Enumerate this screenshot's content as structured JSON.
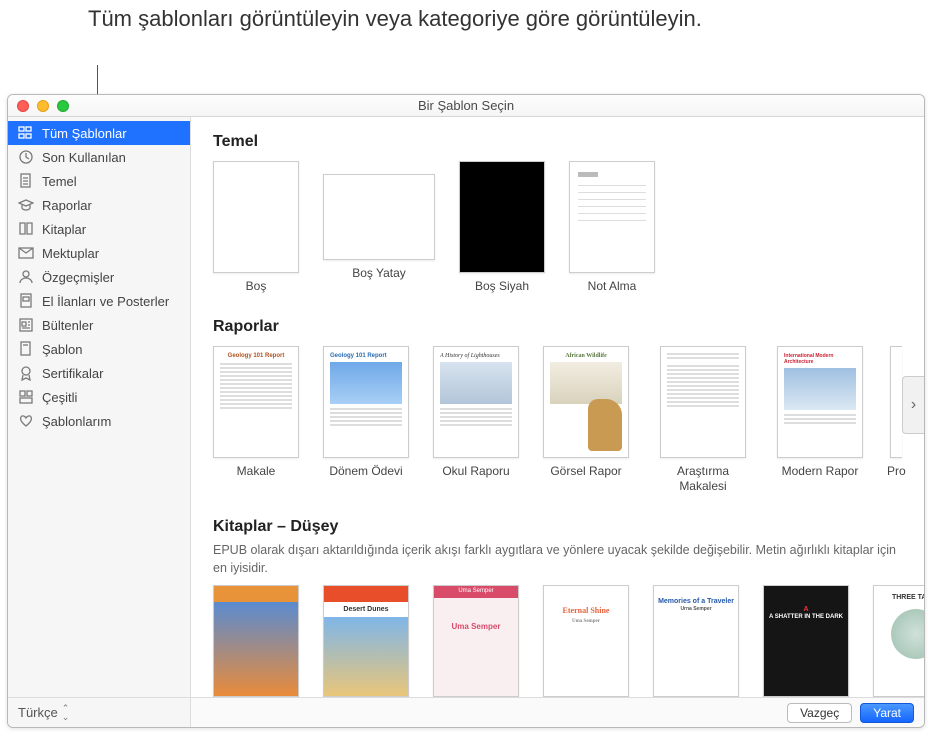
{
  "callout_text": "Tüm şablonları görüntüleyin veya kategoriye göre görüntüleyin.",
  "window_title": "Bir Şablon Seçin",
  "sidebar": {
    "categories": [
      {
        "label": "Tüm Şablonlar",
        "icon": "grid",
        "selected": true
      },
      {
        "label": "Son Kullanılan",
        "icon": "clock",
        "selected": false
      },
      {
        "label": "Temel",
        "icon": "doc",
        "selected": false
      },
      {
        "label": "Raporlar",
        "icon": "gradcap",
        "selected": false
      },
      {
        "label": "Kitaplar",
        "icon": "book",
        "selected": false
      },
      {
        "label": "Mektuplar",
        "icon": "envelope",
        "selected": false
      },
      {
        "label": "Özgeçmişler",
        "icon": "person",
        "selected": false
      },
      {
        "label": "El İlanları ve Posterler",
        "icon": "poster",
        "selected": false
      },
      {
        "label": "Bültenler",
        "icon": "news",
        "selected": false
      },
      {
        "label": "Şablon",
        "icon": "stationery",
        "selected": false
      },
      {
        "label": "Sertifikalar",
        "icon": "ribbon",
        "selected": false
      },
      {
        "label": "Çeşitli",
        "icon": "misc",
        "selected": false
      },
      {
        "label": "Şablonlarım",
        "icon": "heart",
        "selected": false
      }
    ],
    "language": "Türkçe"
  },
  "sections": {
    "temel": {
      "title": "Temel",
      "templates": [
        {
          "label": "Boş"
        },
        {
          "label": "Boş Yatay"
        },
        {
          "label": "Boş Siyah"
        },
        {
          "label": "Not Alma"
        }
      ]
    },
    "raporlar": {
      "title": "Raporlar",
      "templates": [
        {
          "label": "Makale",
          "thumb_title": "Geology 101 Report"
        },
        {
          "label": "Dönem Ödevi",
          "thumb_title": "Geology 101 Report"
        },
        {
          "label": "Okul Raporu",
          "thumb_title": "A History of Lighthouses"
        },
        {
          "label": "Görsel Rapor",
          "thumb_title": "African Wildlife"
        },
        {
          "label": "Araştırma Makalesi"
        },
        {
          "label": "Modern Rapor",
          "thumb_title": "International Modern Architecture"
        },
        {
          "label": "Pro",
          "partial": true
        }
      ]
    },
    "kitaplar": {
      "title": "Kitaplar – Düşey",
      "subtitle": "EPUB olarak dışarı aktarıldığında içerik akışı farklı aygıtlara ve yönlere uyacak şekilde değişebilir. Metin ağırlıklı kitaplar için en iyisidir.",
      "templates": [
        {
          "cover_title": ""
        },
        {
          "cover_title": "Desert Dunes"
        },
        {
          "cover_title": "Uma Semper"
        },
        {
          "cover_title": "Eternal Shine",
          "cover_author": "Uma Semper"
        },
        {
          "cover_title": "Memories of a Traveler",
          "cover_author": "Urna Semper"
        },
        {
          "cover_title": "A SHATTER IN THE DARK"
        },
        {
          "cover_title": "THREE TALES"
        }
      ]
    }
  },
  "footer": {
    "cancel": "Vazgeç",
    "create": "Yarat"
  }
}
